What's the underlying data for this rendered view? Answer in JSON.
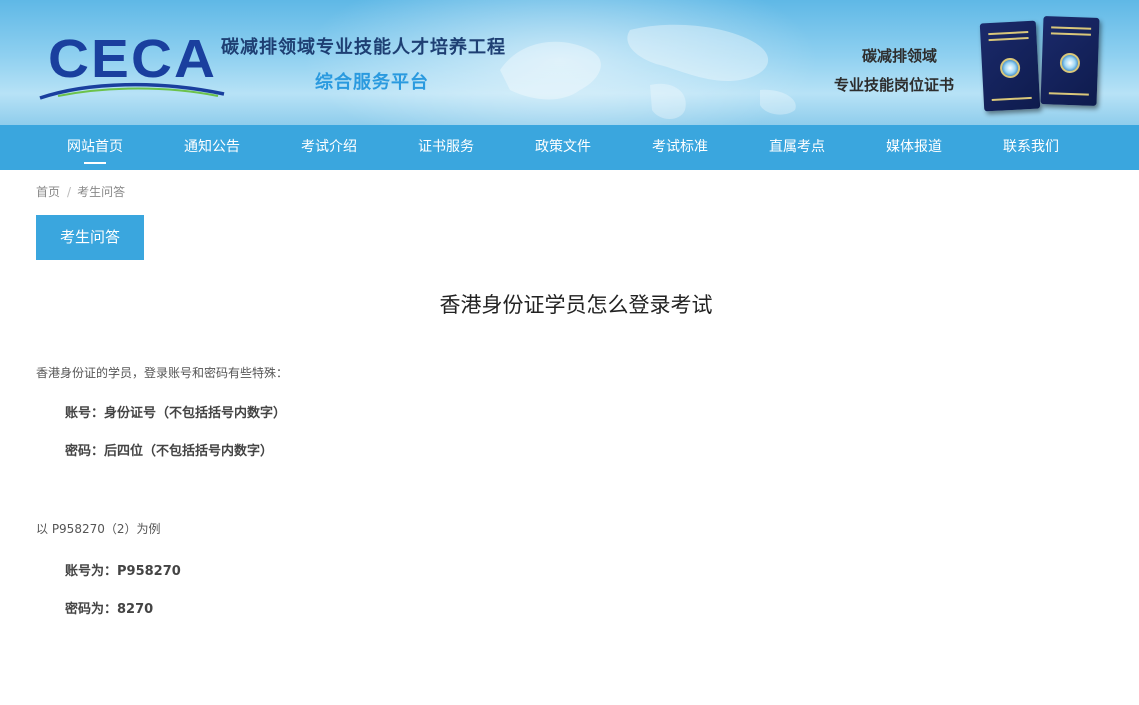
{
  "header": {
    "logo_text": "CECA",
    "title_main": "碳减排领域专业技能人才培养工程",
    "title_sub": "综合服务平台",
    "cert_line1": "碳减排领域",
    "cert_line2": "专业技能岗位证书"
  },
  "nav": {
    "items": [
      {
        "label": "网站首页",
        "active": true
      },
      {
        "label": "通知公告"
      },
      {
        "label": "考试介绍"
      },
      {
        "label": "证书服务"
      },
      {
        "label": "政策文件"
      },
      {
        "label": "考试标准"
      },
      {
        "label": "直属考点"
      },
      {
        "label": "媒体报道"
      },
      {
        "label": "联系我们"
      }
    ]
  },
  "breadcrumb": {
    "home": "首页",
    "separator": "/",
    "current": "考生问答"
  },
  "category_tab": "考生问答",
  "article": {
    "title": "香港身份证学员怎么登录考试",
    "intro": "香港身份证的学员，登录账号和密码有些特殊：",
    "account_rule": "账号：身份证号（不包括括号内数字）",
    "password_rule": "密码：后四位（不包括括号内数字）",
    "example_intro": "以 P958270（2）为例",
    "example_account": "账号为：P958270",
    "example_password": "密码为：8270"
  },
  "colors": {
    "nav_bg": "#3aa6de",
    "title_main": "#1e3f73",
    "title_sub": "#2a9adf",
    "logo": "#1a3f9e"
  }
}
